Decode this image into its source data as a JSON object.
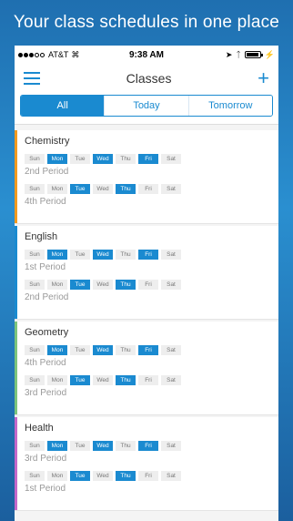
{
  "tagline": "Your class schedules in one place",
  "status": {
    "carrier": "AT&T",
    "time": "9:38 AM"
  },
  "nav": {
    "title": "Classes"
  },
  "tabs": [
    {
      "label": "All",
      "active": true
    },
    {
      "label": "Today",
      "active": false
    },
    {
      "label": "Tomorrow",
      "active": false
    }
  ],
  "day_labels": [
    "Sun",
    "Mon",
    "Tue",
    "Wed",
    "Thu",
    "Fri",
    "Sat"
  ],
  "classes": [
    {
      "name": "Chemistry",
      "color": "#f39a1e",
      "schedules": [
        {
          "active_days": [
            1,
            3,
            5
          ],
          "period": "2nd Period"
        },
        {
          "active_days": [
            2,
            4
          ],
          "period": "4th Period"
        }
      ]
    },
    {
      "name": "English",
      "color": "#1a8ad0",
      "schedules": [
        {
          "active_days": [
            1,
            3,
            5
          ],
          "period": "1st Period"
        },
        {
          "active_days": [
            2,
            4
          ],
          "period": "2nd Period"
        }
      ]
    },
    {
      "name": "Geometry",
      "color": "#7cc47c",
      "schedules": [
        {
          "active_days": [
            1,
            3,
            5
          ],
          "period": "4th Period"
        },
        {
          "active_days": [
            2,
            4
          ],
          "period": "3rd Period"
        }
      ]
    },
    {
      "name": "Health",
      "color": "#c468c9",
      "schedules": [
        {
          "active_days": [
            1,
            3,
            5
          ],
          "period": "3rd Period"
        },
        {
          "active_days": [
            2,
            4
          ],
          "period": "1st Period"
        }
      ]
    }
  ]
}
